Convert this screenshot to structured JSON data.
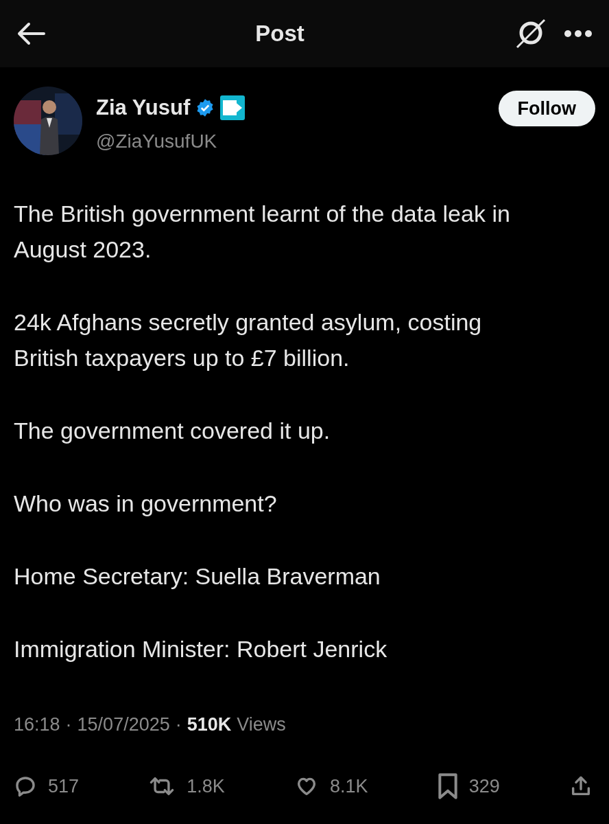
{
  "header": {
    "title": "Post"
  },
  "author": {
    "name": "Zia Yusuf",
    "verified": true,
    "affiliate": true,
    "handle": "@ZiaYusufUK",
    "follow_label": "Follow"
  },
  "paragraphs": [
    "The British government learnt of the data leak in August 2023.",
    "24k Afghans secretly granted asylum, costing British taxpayers up to £7 billion.",
    "The government covered it up.",
    "Who was in government?",
    "Home Secretary: Suella Braverman",
    "Immigration Minister: Robert Jenrick"
  ],
  "meta": {
    "time": "16:18",
    "date": "15/07/2025",
    "views_count": "510K",
    "views_label": "Views",
    "separator": "·"
  },
  "actions": [
    {
      "kind": "reply",
      "count": "517"
    },
    {
      "kind": "repost",
      "count": "1.8K"
    },
    {
      "kind": "like",
      "count": "8.1K"
    },
    {
      "kind": "bookmark",
      "count": "329"
    },
    {
      "kind": "share"
    }
  ]
}
